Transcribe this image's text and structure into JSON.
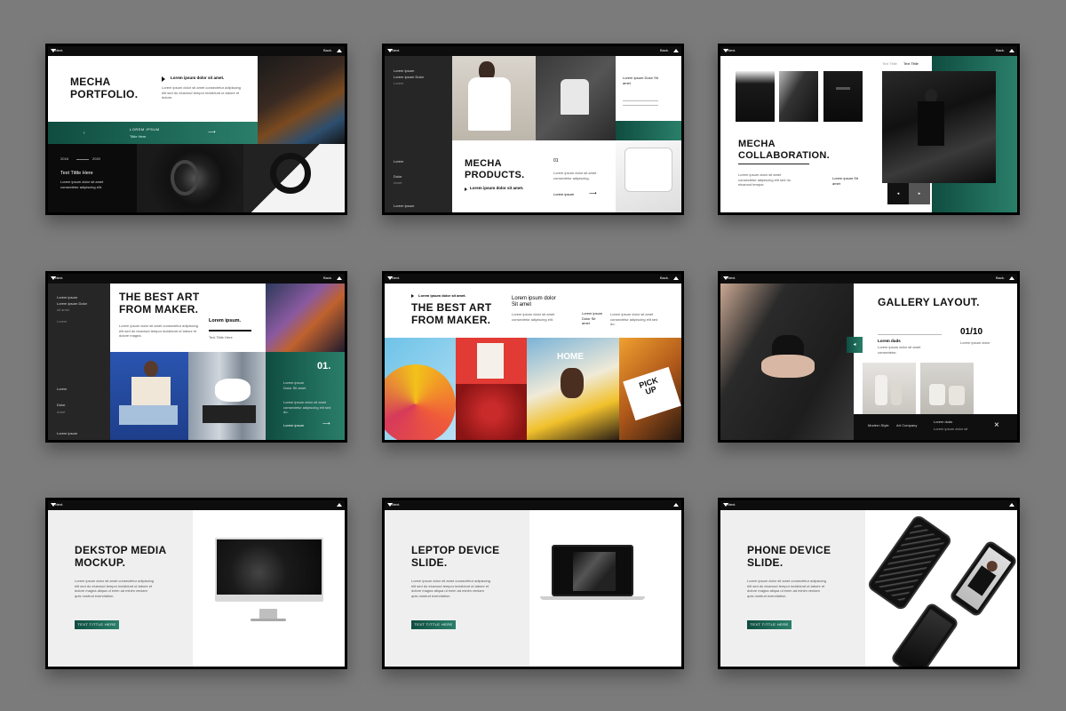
{
  "common": {
    "nav_left": "Next.",
    "nav_right": "Back."
  },
  "slide1": {
    "title_1": "MECHA",
    "title_2": "PORTFOLIO.",
    "heading": "Lorem ipsum dolor sit amet.",
    "body": "Lorem ipsum dolor sit amet consectetur adipiscing elit sed do eiusmod tempor incididunt ut labore et dolore.",
    "band_label": "LOREM IPSUM",
    "band_sub": "Tittle Here",
    "year_a": "2018",
    "year_b": "2020",
    "dark_title": "Text Tittle Here",
    "dark_body": "Lorem ipsum dolor sit amet consectetur adipiscing elit."
  },
  "slide2": {
    "side_1": "Lorem Ipsum",
    "side_2": "Lorem Ipsum Dolor",
    "side_3": "Lorem",
    "side_4": "Lorem",
    "side_5": "Dolor",
    "side_6": "Amet",
    "side_7": "Lorem Ipsum",
    "right_title": "Lorem Ipsum Dolor Sit amet",
    "title_1": "MECHA",
    "title_2": "PRODUCTS.",
    "sub": "Lorem ipsum dolor sit amet.",
    "num": "01",
    "link": "Lorem ipsum"
  },
  "slide3": {
    "tab_1": "Text Tittle",
    "tab_2": "Text Tittle",
    "title_1": "MECHA",
    "title_2": "COLLABORATION.",
    "caption": "Lorem ipsum Sit amet"
  },
  "slide4": {
    "side_1": "Lorem ipsum",
    "side_2": "Lorem Ipsum Dolor",
    "side_3": "sit amet",
    "side_4": "Lorem",
    "side_5": "Lorem",
    "side_6": "Dolor",
    "side_7": "Amet",
    "side_8": "Lorem ipsum",
    "title_1": "THE BEST ART",
    "title_2": "FROM MAKER.",
    "label": "Lorem ipsum.",
    "label_sub": "Text Tittle Here",
    "num": "01.",
    "teal_text": "Lorem ipsum Dolor Sit amet",
    "teal_link": "Lorem ipsum"
  },
  "slide5": {
    "top": "Lorem ipsum dolor sit amet.",
    "title_1": "THE BEST ART",
    "title_2": "FROM MAKER.",
    "mid_1": "Lorem ipsum dolor",
    "mid_2": "Sit amet",
    "right_text": "Lorem ipsum Dolor Sit amet",
    "home": "HOME",
    "pick_1": "PICK",
    "pick_2": "UP"
  },
  "slide6": {
    "title": "GALLERY LAYOUT.",
    "count": "01/10",
    "count_sub": "Lorem ipsum dolor",
    "label": "Lorem duds",
    "bar_1": "Modern Style",
    "bar_2": "Art Company",
    "bar_3": "Lorem duds",
    "bar_4": "Lorem ipsum dolor sit"
  },
  "slide7": {
    "title_1": "DEKSTOP MEDIA",
    "title_2": "MOCKUP.",
    "button": "TEXT TITTLE HERE"
  },
  "slide8": {
    "title_1": "LEPTOP DEVICE",
    "title_2": "SLIDE.",
    "button": "TEXT TITTLE HERE"
  },
  "slide9": {
    "title_1": "PHONE DEVICE",
    "title_2": "SLIDE.",
    "button": "TEXT TITTLE HERE"
  },
  "colors": {
    "teal_dark": "#0f4d40",
    "teal_light": "#2a7f6a",
    "background": "#7b7b7b"
  }
}
